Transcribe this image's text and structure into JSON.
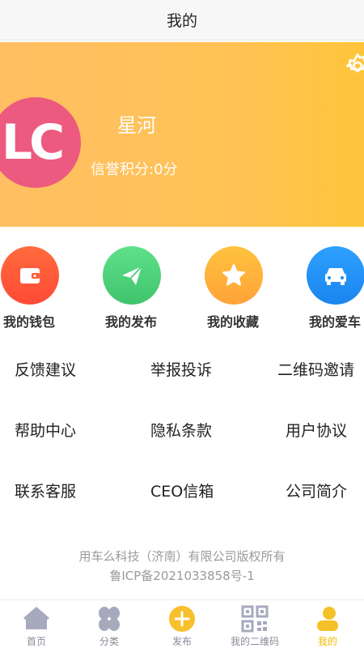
{
  "nav": {
    "title": "我的"
  },
  "profile": {
    "avatar_text": "LC",
    "username": "星河",
    "credit": "信誉积分:0分"
  },
  "quick_actions": [
    {
      "label": "我的钱包",
      "icon": "wallet-icon",
      "color": "#ff5c3a"
    },
    {
      "label": "我的发布",
      "icon": "paper-plane-icon",
      "color": "#4fd07b"
    },
    {
      "label": "我的收藏",
      "icon": "star-icon",
      "color": "#ffaa33"
    },
    {
      "label": "我的爱车",
      "icon": "car-icon",
      "color": "#1f8ef5"
    }
  ],
  "menu": [
    [
      "反馈建议",
      "举报投诉",
      "二维码邀请"
    ],
    [
      "帮助中心",
      "隐私条款",
      "用户协议"
    ],
    [
      "联系客服",
      "CEO信箱",
      "公司简介"
    ]
  ],
  "footer": {
    "copyright": "用车么科技（济南）有限公司版权所有",
    "icp": "鲁ICP备2021033858号-1"
  },
  "tabs": [
    {
      "label": "首页",
      "icon": "home-icon"
    },
    {
      "label": "分类",
      "icon": "category-icon"
    },
    {
      "label": "发布",
      "icon": "plus-circle-icon"
    },
    {
      "label": "我的二维码",
      "icon": "qrcode-icon"
    },
    {
      "label": "我的",
      "icon": "user-icon",
      "active": true
    }
  ]
}
